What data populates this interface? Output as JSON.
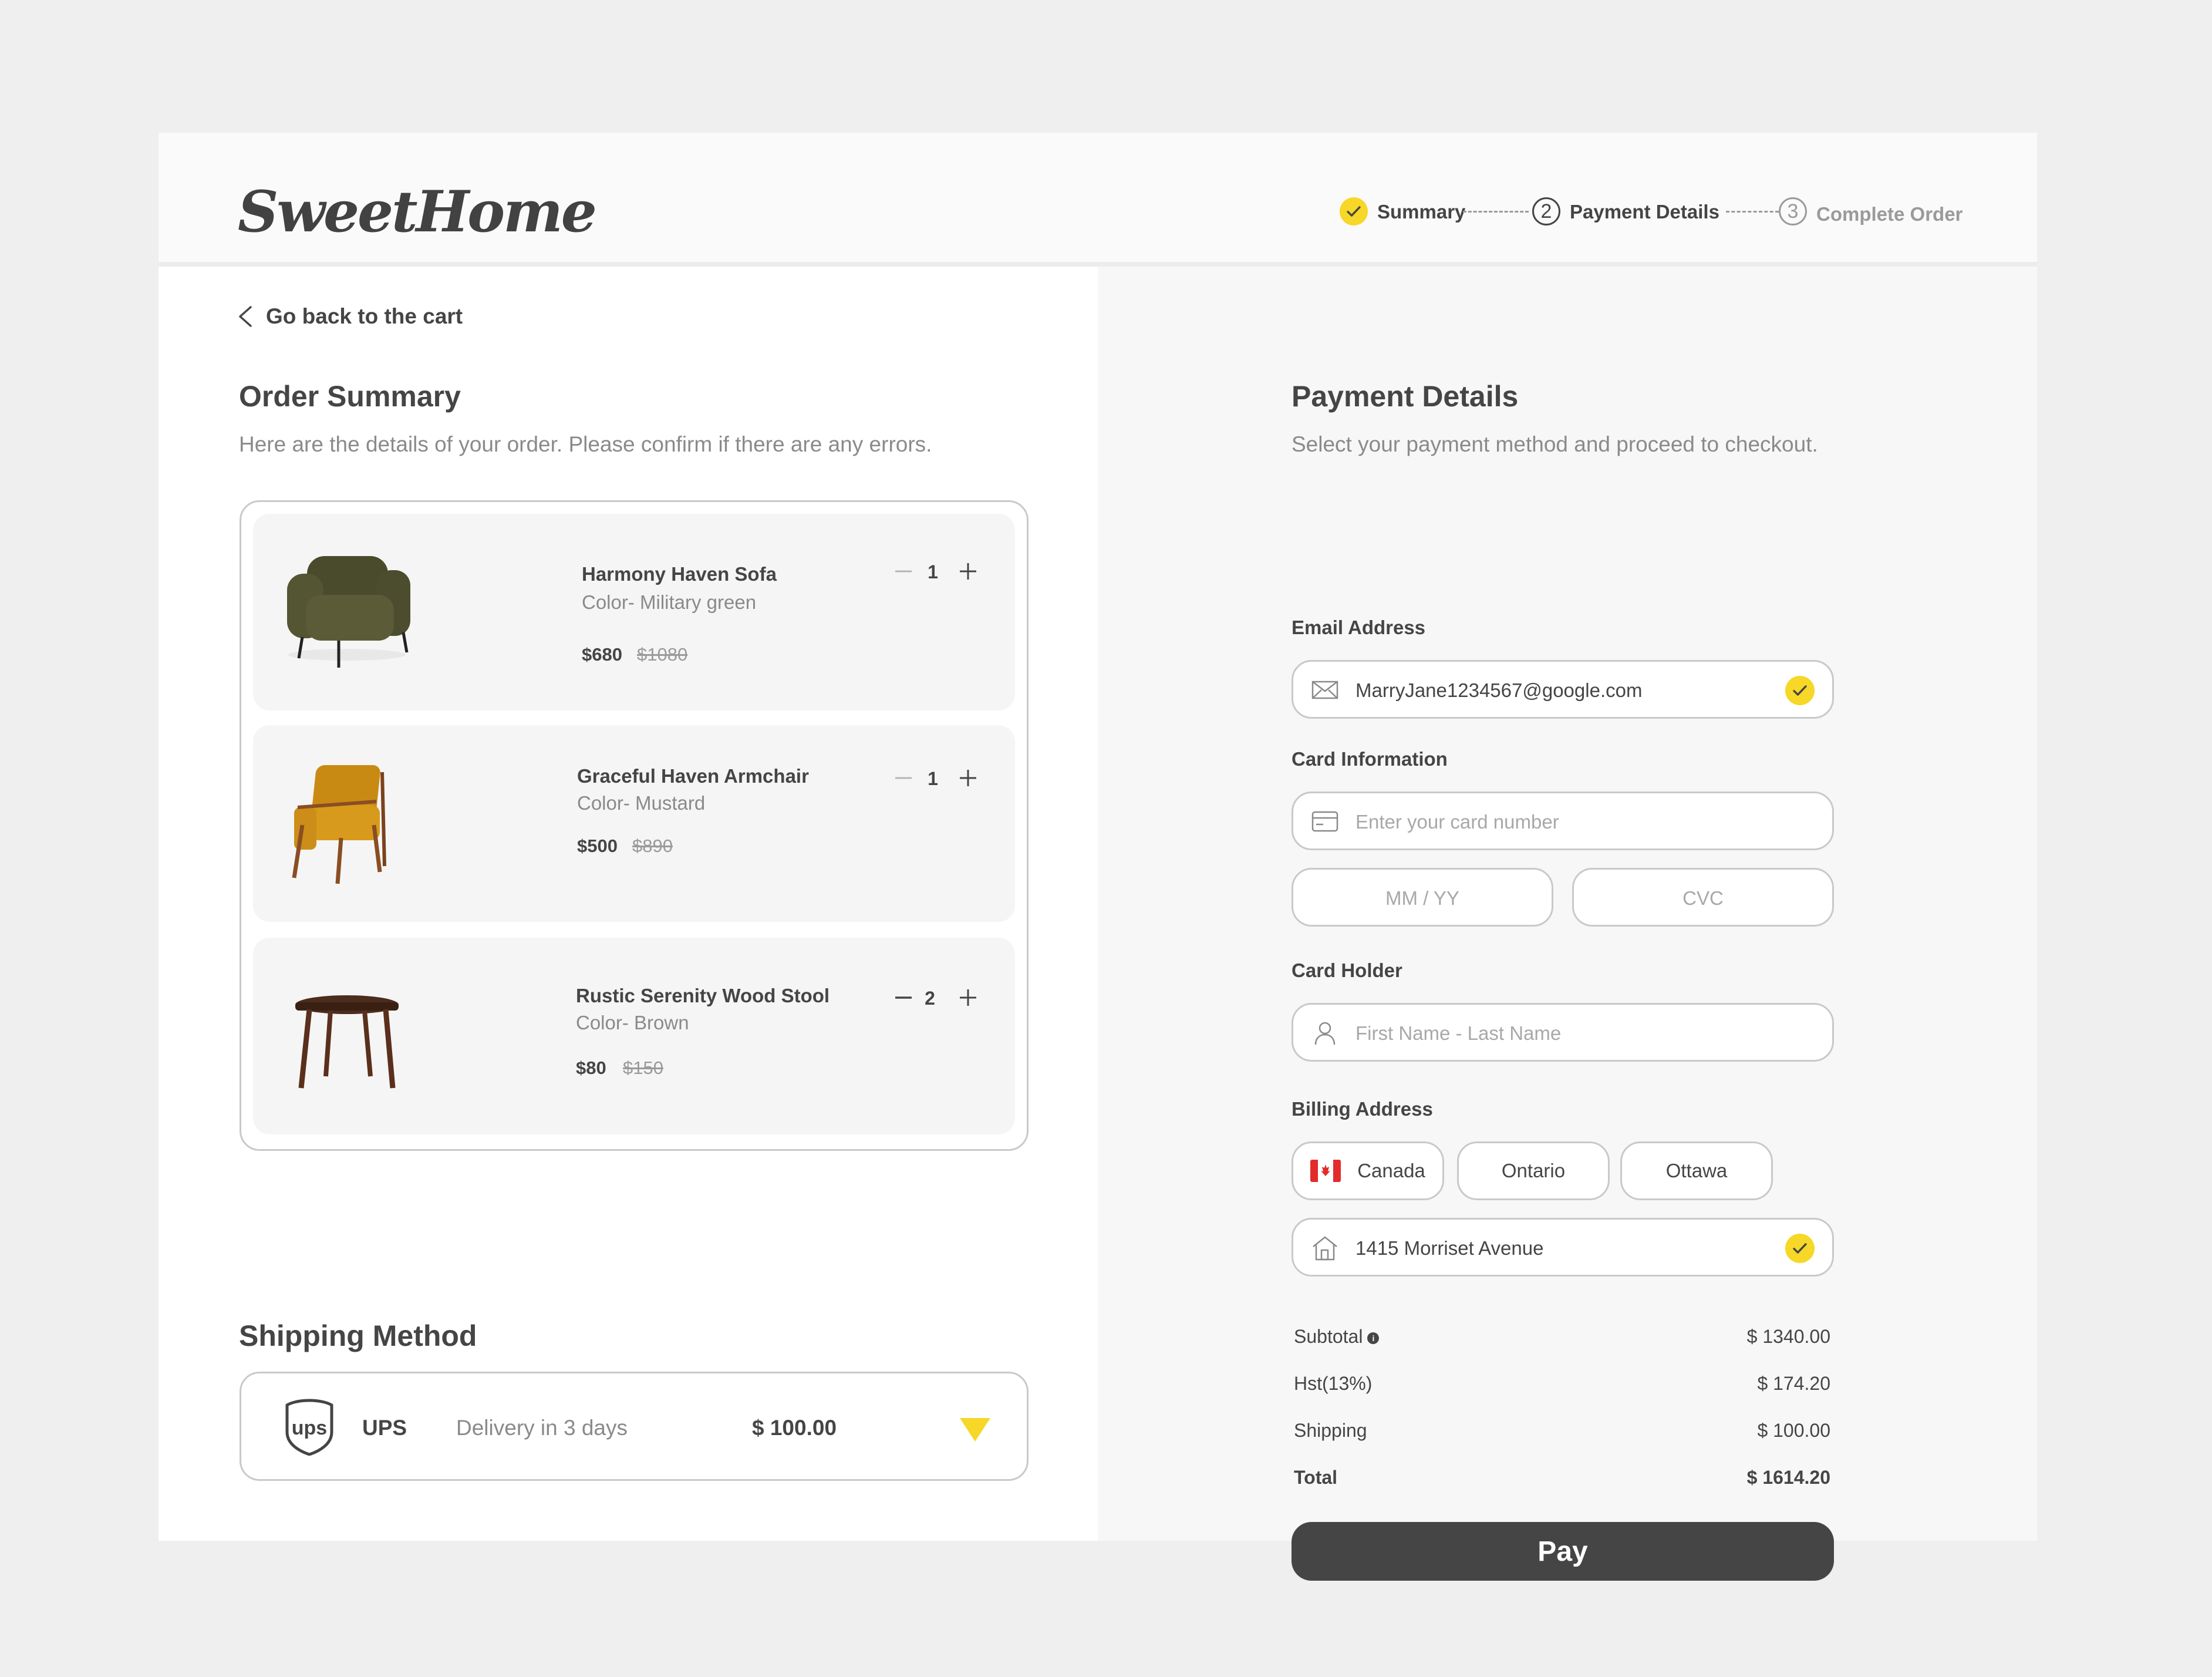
{
  "brand": {
    "logo": "SweetHome"
  },
  "stepper": {
    "steps": [
      {
        "number": "1",
        "label": "Summary",
        "status": "done"
      },
      {
        "number": "2",
        "label": "Payment Details",
        "status": "active"
      },
      {
        "number": "3",
        "label": "Complete Order",
        "status": "pending"
      }
    ]
  },
  "order": {
    "back_label": "Go back to the cart",
    "title": "Order Summary",
    "subtitle": "Here are the details of your order. Please confirm if there are any errors.",
    "items": [
      {
        "name": "Harmony Haven Sofa",
        "color": "Color- Military green",
        "price": "$680",
        "old_price": "$1080",
        "qty": "1",
        "image": "armchair-green"
      },
      {
        "name": "Graceful Haven Armchair",
        "color": "Color- Mustard",
        "price": "$500",
        "old_price": "$890",
        "qty": "1",
        "image": "armchair-mustard"
      },
      {
        "name": "Rustic Serenity Wood Stool",
        "color": "Color- Brown",
        "price": "$80",
        "old_price": "$150",
        "qty": "2",
        "image": "wood-stool"
      }
    ]
  },
  "shipping": {
    "title": "Shipping Method",
    "carrier": "UPS",
    "eta": "Delivery in 3 days",
    "cost": "$ 100.00"
  },
  "payment": {
    "title": "Payment Details",
    "subtitle": "Select your payment method and proceed to checkout.",
    "email_label": "Email Address",
    "email_value": "MarryJane1234567@google.com",
    "card_label": "Card Information",
    "card_placeholder": "Enter your card number",
    "expiry_placeholder": "MM / YY",
    "cvc_placeholder": "CVC",
    "holder_label": "Card Holder",
    "holder_placeholder": "First Name - Last Name",
    "billing_label": "Billing Address",
    "country": "Canada",
    "province": "Ontario",
    "city": "Ottawa",
    "address": "1415 Morriset Avenue",
    "summary": {
      "subtotal_label": "Subtotal",
      "subtotal": "$ 1340.00",
      "hst_label": "Hst(13%)",
      "hst": "$ 174.20",
      "shipping_label": "Shipping",
      "shipping": "$ 100.00",
      "total_label": "Total",
      "total": "$ 1614.20"
    },
    "pay_label": "Pay"
  },
  "colors": {
    "accent": "#f7d727",
    "dark": "#454545",
    "muted": "#8a8a8a",
    "border": "#c9c9c9"
  }
}
